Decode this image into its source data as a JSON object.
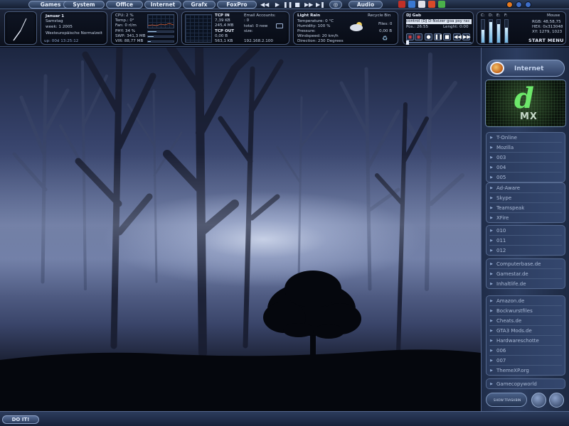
{
  "menubar": {
    "items": [
      "Games",
      "System",
      "Office",
      "Internet",
      "Grafx",
      "FoxPro",
      "Audio"
    ],
    "media_controls": [
      "◀◀",
      "▶",
      "❚❚",
      "■",
      "▶▶",
      "▶❚"
    ],
    "misc_button": "◎",
    "window_orbs": [
      {
        "name": "minimize-orb",
        "color": "#e67a1e"
      },
      {
        "name": "maximize-orb",
        "color": "#3e6ec8"
      },
      {
        "name": "close-orb",
        "color": "#3e6ec8"
      }
    ]
  },
  "clock_widget": {
    "date": "Januar 1",
    "day": "Samstag",
    "week": "week: 1 2005",
    "timezone": "Westeuropäische Normalzeit",
    "uptime": "up: 00d 13:25:12"
  },
  "system_widget": {
    "cpu": "CPU: 2 %",
    "temp": "Temp.: 0°",
    "fan": "Fan: 0 rl/m",
    "phy": "PHY: 34 %",
    "swp": "SWP: 341,3 MB",
    "vir": "VIR: 88,77 MB",
    "phy_level": 0.34,
    "swp_level": 0.22,
    "vir_level": 0.1
  },
  "network_widget": {
    "tcp_in_label": "TCP IN",
    "tcp_in_rate": "7,39 KB",
    "tcp_in_total": "245,4 MB",
    "tcp_out_label": "TCP OUT",
    "tcp_out_rate": "0,00 B",
    "tcp_out_total": "563,1 KB",
    "email_label": "Email Accounts:",
    "email_count": ": 0",
    "email_total": "total: 0 new",
    "email_size": "size:",
    "ip": "192.168.2.100"
  },
  "weather_widget": {
    "condition": "Light Rain",
    "temperature": "Temperature: 0 °C",
    "humidity": "Humidity: 100 %",
    "pressure": "Pressure:",
    "windspeed": "Windspeed: 20 km/h",
    "direction": "Direction: 230 Degrees",
    "recycle_label": "Recycle Bin",
    "recycle_files": "Files: 0",
    "recycle_size": "0,00 B"
  },
  "player_widget": {
    "title": "DJ Gab",
    "track": "control (DJ D-Noizer goa psy rac",
    "pos": "Pos.: 26:55",
    "length": "Lenght: 0:00",
    "buttons": [
      "◉",
      "◉",
      "●",
      "❚❚",
      "■",
      "◀◀",
      "▶▶"
    ],
    "level_labels": [
      "C:",
      "D:",
      "E:",
      "F:"
    ],
    "levels": [
      0.55,
      0.9,
      0.8,
      0.65
    ],
    "mouse_label": "Mouse",
    "rgb": "RGB: 48,58,75",
    "hex": "HEX: 0x313048",
    "xy": "XY: 1279, 1023",
    "start_menu": "START MENU"
  },
  "sidebar": {
    "internet": "Internet",
    "dmx_mx": "MX",
    "group1": [
      "T-Online",
      "Mozilla",
      "003",
      "004",
      "005"
    ],
    "group2": [
      "Ad-Aware",
      "Skype",
      "Teamspeak",
      "XFire"
    ],
    "group3": [
      "010",
      "011",
      "012"
    ],
    "group4": [
      "Computerbase.de",
      "Gamestar.de",
      "Inhaltlife.de"
    ],
    "group5": [
      "Amazon.de",
      "Bockwurstfiles",
      "Cheats.de",
      "GTA3 Mods.de",
      "Hardwareschotte",
      "006",
      "007",
      "ThemeXP.org"
    ],
    "group6": [
      "Gamecopyworld"
    ],
    "show_trashbin": "SHOW TRASHBIN"
  },
  "taskbar": {
    "doit": "DO IT!"
  }
}
